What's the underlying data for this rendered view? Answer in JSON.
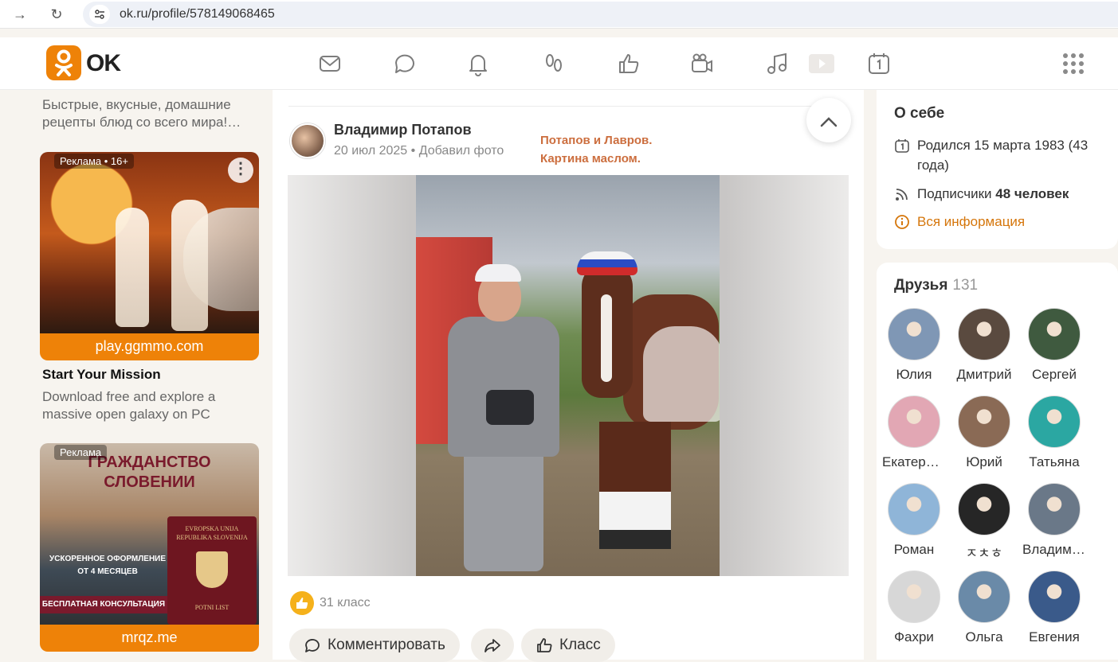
{
  "browser": {
    "url": "ok.ru/profile/578149068465",
    "back_label": "→",
    "reload_label": "↻"
  },
  "header": {
    "logo_text": "OK",
    "icons": [
      "messages-icon",
      "discussions-icon",
      "notifications-icon",
      "guests-icon",
      "events-icon",
      "video-icon",
      "music-icon",
      "games-icon",
      "calendar-icon",
      "apps-icon"
    ]
  },
  "left": {
    "promo_text": "Быстрые, вкусные, домашние рецепты блюд со всего мира!…",
    "ad1": {
      "badge": "Реклама • 16+",
      "more": "⋮",
      "domain": "play.ggmmo.com",
      "title": "Start Your Mission",
      "description": "Download free and explore a massive open galaxy on PC"
    },
    "ad2": {
      "badge": "Реклама",
      "headline_1": "ГРАЖДАНСТВО",
      "headline_2": "СЛОВЕНИИ",
      "passport_top_1": "EVROPSKA UNIJA",
      "passport_top_2": "REPUBLIKA SLOVENIJA",
      "passport_bottom": "POTNI LIST",
      "fast_1": "УСКОРЕННОЕ ОФОРМЛЕНИЕ",
      "fast_2": "ОТ 4 МЕСЯЦЕВ",
      "consult": "БЕСПЛАТНАЯ КОНСУЛЬТАЦИЯ",
      "domain": "mrqz.me"
    }
  },
  "post": {
    "author": "Владимир Потапов",
    "date": "20 июл 2025",
    "action": "Добавил фото",
    "caption_1": "Потапов и Лавров.",
    "caption_2": "Картина маслом.",
    "collapse": "⌃",
    "likes": "31 класс",
    "comment_label": "Комментировать",
    "like_label": "Класс"
  },
  "about": {
    "title": "О себе",
    "born": "Родился 15 марта 1983 (43 года)",
    "subscribers_label": "Подписчики",
    "subscribers_value": "48 человек",
    "all_info": "Вся информация"
  },
  "friends": {
    "title": "Друзья",
    "count": "131",
    "list": [
      {
        "name": "Юлия",
        "color": "#7f97b5"
      },
      {
        "name": "Дмитрий",
        "color": "#5a4a3f"
      },
      {
        "name": "Сергей",
        "color": "#3f5a3f"
      },
      {
        "name": "Екатерина",
        "color": "#e2a7b4"
      },
      {
        "name": "Юрий",
        "color": "#8a6a55"
      },
      {
        "name": "Татьяна",
        "color": "#2ba7a2"
      },
      {
        "name": "Роман",
        "color": "#8fb5d8"
      },
      {
        "name": "ㅈㅊㅎ",
        "color": "#262626"
      },
      {
        "name": "Владимир",
        "color": "#6a7888"
      },
      {
        "name": "Фахри",
        "color": "#d7d7d7"
      },
      {
        "name": "Ольга",
        "color": "#6a8aa8"
      },
      {
        "name": "Евгения",
        "color": "#3a5a8a"
      }
    ]
  },
  "colors": {
    "ok_orange": "#ee8208",
    "like_gold": "#f5b11b",
    "caption": "#cc6e3e"
  }
}
